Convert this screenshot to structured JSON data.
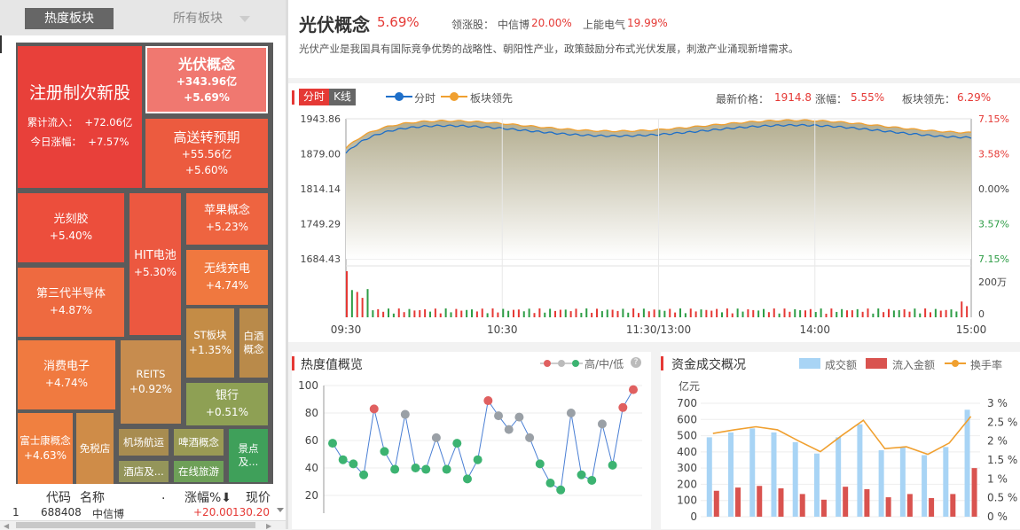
{
  "tabs": {
    "hot": "热度板块",
    "all": "所有板块"
  },
  "treemap": [
    {
      "id": "zhuce",
      "name": "注册制次新股",
      "lines": [
        "累计流入：  +72.06亿",
        "今日涨幅：  +7.57%"
      ],
      "color": "#e8403a"
    },
    {
      "id": "guangfu",
      "name": "光伏概念",
      "lines": [
        "+343.96亿",
        "+5.69%"
      ],
      "color": "#f07870",
      "selected": true
    },
    {
      "id": "gaosong",
      "name": "高送转预期",
      "lines": [
        "+55.56亿",
        "+5.60%"
      ],
      "color": "#ec5b3f"
    },
    {
      "id": "guangke",
      "name": "光刻胶",
      "lines": [
        "+5.40%"
      ],
      "color": "#ec4e3c"
    },
    {
      "id": "hit",
      "name": "HIT电池",
      "lines": [
        "+5.30%"
      ],
      "color": "#ec5840"
    },
    {
      "id": "pingguo",
      "name": "苹果概念",
      "lines": [
        "+5.23%"
      ],
      "color": "#ee6440"
    },
    {
      "id": "wuxian",
      "name": "无线充电",
      "lines": [
        "+4.74%"
      ],
      "color": "#f0783f"
    },
    {
      "id": "disandai",
      "name": "第三代半导体",
      "lines": [
        "+4.87%"
      ],
      "color": "#ee6a40"
    },
    {
      "id": "xiaofei",
      "name": "消费电子",
      "lines": [
        "+4.74%"
      ],
      "color": "#f07a40"
    },
    {
      "id": "reits",
      "name": "REITS",
      "lines": [
        "+0.92%"
      ],
      "color": "#c78c4e"
    },
    {
      "id": "st",
      "name": "ST板块",
      "lines": [
        "+1.35%"
      ],
      "color": "#c48c46"
    },
    {
      "id": "baijiu",
      "name": "白酒概念",
      "lines": [],
      "color": "#b98a4a"
    },
    {
      "id": "yinhang",
      "name": "银行",
      "lines": [
        "+0.51%"
      ],
      "color": "#8ea054"
    },
    {
      "id": "fushikang",
      "name": "富士康概念",
      "lines": [
        "+4.63%"
      ],
      "color": "#f08040"
    },
    {
      "id": "mianshui",
      "name": "免税店",
      "lines": [],
      "color": "#cf8c48"
    },
    {
      "id": "jichang",
      "name": "机场航运",
      "lines": [],
      "color": "#a88c50"
    },
    {
      "id": "pijiu",
      "name": "啤酒概念",
      "lines": [],
      "color": "#9a9a54"
    },
    {
      "id": "jingdian",
      "name": "景点及...",
      "lines": [],
      "color": "#3fa05a"
    },
    {
      "id": "jiudian",
      "name": "酒店及...",
      "lines": [],
      "color": "#94955a"
    },
    {
      "id": "zaixian",
      "name": "在线旅游",
      "lines": [],
      "color": "#6ea058"
    }
  ],
  "table": {
    "headers": [
      "代码",
      "名称",
      ".",
      "涨幅%⬇",
      "现价"
    ],
    "row": {
      "idx": "1",
      "code": "688408",
      "name": "中信博",
      "change": "+20.00",
      "price": "130.20"
    }
  },
  "sector": {
    "name": "光伏概念",
    "pct": "5.69%",
    "lead_label": "领涨股：",
    "lead1_name": "中信博",
    "lead1_pct": "20.00%",
    "lead2_name": "上能电气",
    "lead2_pct": "19.99%",
    "desc": "光伏产业是我国具有国际竞争优势的战略性、朝阳性产业，政策鼓励分布式光伏发展，刺激产业涌现新增需求。"
  },
  "intraday": {
    "tab_fenshi": "分时",
    "tab_kline": "K线",
    "legend_fenshi": "分时",
    "legend_lead": "板块领先",
    "latest_label": "最新价格：",
    "latest_value": "1914.8",
    "change_label": "涨幅：",
    "change_value": "5.55%",
    "lead_label": "板块领先：",
    "lead_value": "6.29%",
    "y_left": [
      "1943.86",
      "1879.00",
      "1814.14",
      "1749.29",
      "1684.43"
    ],
    "y_right": [
      "7.15%",
      "3.58%",
      "0.00%",
      "3.57%",
      "7.15%"
    ],
    "vol_labels": [
      "200万",
      "0"
    ],
    "x_labels": [
      "09:30",
      "10:30",
      "11:30/13:00",
      "14:00",
      "15:00"
    ]
  },
  "heat": {
    "title": "热度值概览",
    "legend": "高/中/低",
    "y": [
      "100",
      "80",
      "60",
      "40",
      "20"
    ],
    "values": [
      58,
      46,
      43,
      35,
      83,
      52,
      39,
      79,
      40,
      39,
      62,
      39,
      58,
      32,
      46,
      89,
      78,
      68,
      77,
      62,
      43,
      29,
      24,
      80,
      35,
      31,
      72,
      42,
      84,
      97
    ],
    "colors": [
      "#3cb371",
      "#3cb371",
      "#3cb371",
      "#3cb371",
      "#e06060",
      "#3cb371",
      "#3cb371",
      "#9aa0a6",
      "#3cb371",
      "#3cb371",
      "#9aa0a6",
      "#3cb371",
      "#3cb371",
      "#3cb371",
      "#3cb371",
      "#e06060",
      "#9aa0a6",
      "#9aa0a6",
      "#9aa0a6",
      "#9aa0a6",
      "#3cb371",
      "#3cb371",
      "#3cb371",
      "#9aa0a6",
      "#3cb371",
      "#3cb371",
      "#9aa0a6",
      "#3cb371",
      "#e06060",
      "#e06060"
    ]
  },
  "fund": {
    "title": "资金成交概况",
    "legend": [
      "成交额",
      "流入金额",
      "换手率"
    ],
    "unit": "亿元",
    "y_left": [
      "700",
      "600",
      "500",
      "400",
      "300",
      "200",
      "100",
      "0"
    ],
    "y_right": [
      "3 %",
      "2.5 %",
      "2 %",
      "1.5 %",
      "1 %",
      "0.5 %",
      "0 %"
    ],
    "volume": [
      490,
      520,
      545,
      520,
      460,
      390,
      490,
      570,
      410,
      430,
      380,
      430,
      660
    ],
    "inflow": [
      160,
      180,
      190,
      175,
      140,
      105,
      185,
      170,
      120,
      140,
      115,
      140,
      300
    ],
    "turnover": [
      2.2,
      2.3,
      2.38,
      2.3,
      2.0,
      1.72,
      2.15,
      2.55,
      1.8,
      1.85,
      1.65,
      1.95,
      2.65
    ]
  },
  "colors": {
    "up": "#e53935",
    "down": "#2e9d46",
    "blue": "#1e6fc9",
    "orange": "#f0a030",
    "lightblue": "#a8d4f5"
  }
}
